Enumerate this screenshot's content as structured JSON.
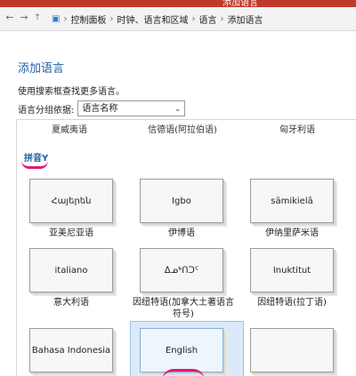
{
  "window": {
    "title": "添加语言"
  },
  "address_bar": {
    "crumbs": [
      "控制面板",
      "时钟、语言和区域",
      "语言",
      "添加语言"
    ],
    "separator": "›"
  },
  "page": {
    "heading": "添加语言",
    "hint": "使用搜索框查找更多语言。",
    "group_by_label": "语言分组依据:",
    "group_by_value": "语言名称"
  },
  "top_row_captions": [
    "夏威夷语",
    "信德语(阿拉伯语)",
    "匈牙利语"
  ],
  "group": {
    "label": "拼音Y"
  },
  "tiles": [
    {
      "text": "Հայերեն",
      "caption": "亚美尼亚语"
    },
    {
      "text": "Igbo",
      "caption": "伊博语"
    },
    {
      "text": "sämikielâ",
      "caption": "伊纳里萨米语"
    },
    {
      "text": "italiano",
      "caption": "意大利语"
    },
    {
      "text": "ᐃᓄᒃᑎᑐᑦ",
      "caption": "因纽特语(加拿大土著语言符号)"
    },
    {
      "text": "Inuktitut",
      "caption": "因纽特语(拉丁语)"
    },
    {
      "text": "Bahasa Indonesia",
      "caption": ""
    },
    {
      "text": "English",
      "caption": ""
    },
    {
      "text": "",
      "caption": ""
    }
  ],
  "colors": {
    "accent": "#1e5fa8",
    "annotation": "#e0197a",
    "selection": "#dbe9f8"
  },
  "icons": [
    "back-arrow-icon",
    "forward-arrow-icon",
    "up-arrow-icon",
    "control-panel-icon",
    "chevron-down-icon"
  ]
}
